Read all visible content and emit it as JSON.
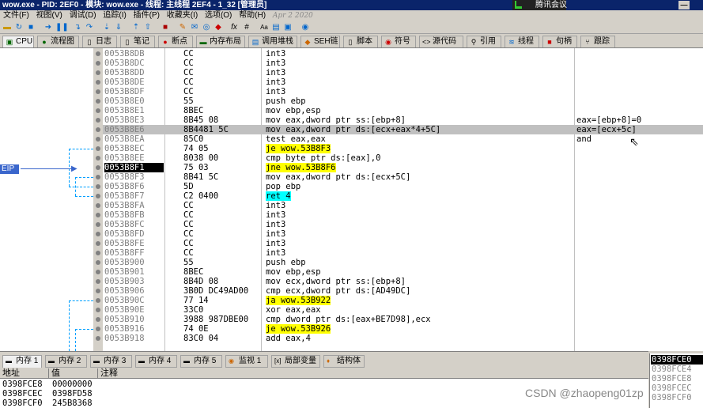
{
  "window": {
    "title": "wow.exe - PID: 2EF0 - 模块: wow.exe - 线程: 主线程 2EF4 - 1_32 [管理员]",
    "meeting": "腾讯会议",
    "minimize": "—"
  },
  "menu": [
    "文件(F)",
    "视图(V)",
    "调试(D)",
    "追踪(I)",
    "插件(P)",
    "收藏夹(I)",
    "选项(O)",
    "帮助(H)"
  ],
  "menu_date": "Apr 2 2020",
  "tabs": [
    {
      "label": "CPU",
      "icon": "cpu-icon"
    },
    {
      "label": "流程图",
      "icon": "graph-icon"
    },
    {
      "label": "日志",
      "icon": "log-icon"
    },
    {
      "label": "笔记",
      "icon": "notes-icon"
    },
    {
      "label": "断点",
      "icon": "breakpoint-icon"
    },
    {
      "label": "内存布局",
      "icon": "memory-map-icon"
    },
    {
      "label": "调用堆栈",
      "icon": "call-stack-icon"
    },
    {
      "label": "SEH链",
      "icon": "seh-icon"
    },
    {
      "label": "脚本",
      "icon": "script-icon"
    },
    {
      "label": "符号",
      "icon": "symbols-icon"
    },
    {
      "label": "源代码",
      "icon": "source-icon"
    },
    {
      "label": "引用",
      "icon": "references-icon"
    },
    {
      "label": "线程",
      "icon": "threads-icon"
    },
    {
      "label": "句柄",
      "icon": "handles-icon"
    },
    {
      "label": "跟踪",
      "icon": "trace-icon"
    }
  ],
  "eip_label": "EIP",
  "disasm": [
    {
      "addr": "0053B8DB",
      "bytes": "CC",
      "instr": "int3",
      "cmt": ""
    },
    {
      "addr": "0053B8DC",
      "bytes": "CC",
      "instr": "int3",
      "cmt": ""
    },
    {
      "addr": "0053B8DD",
      "bytes": "CC",
      "instr": "int3",
      "cmt": ""
    },
    {
      "addr": "0053B8DE",
      "bytes": "CC",
      "instr": "int3",
      "cmt": ""
    },
    {
      "addr": "0053B8DF",
      "bytes": "CC",
      "instr": "int3",
      "cmt": ""
    },
    {
      "addr": "0053B8E0",
      "bytes": "55",
      "instr": "push ebp",
      "cmt": ""
    },
    {
      "addr": "0053B8E1",
      "bytes": "8BEC",
      "instr": "mov ebp,esp",
      "cmt": ""
    },
    {
      "addr": "0053B8E3",
      "bytes": "8B45 08",
      "instr": "mov eax,dword ptr ss:[ebp+8]",
      "cmt": "eax=[ebp+8]=0"
    },
    {
      "addr": "0053B8E6",
      "bytes": "8B4481 5C",
      "instr": "mov eax,dword ptr ds:[ecx+eax*4+5C]",
      "cmt": "eax=[ecx+5c]"
    },
    {
      "addr": "0053B8EA",
      "bytes": "85C0",
      "instr": "test eax,eax",
      "cmt": "and"
    },
    {
      "addr": "0053B8EC",
      "bytes": "74 05",
      "instr": "je wow.53B8F3",
      "cmt": ""
    },
    {
      "addr": "0053B8EE",
      "bytes": "8038 00",
      "instr": "cmp byte ptr ds:[eax],0",
      "cmt": ""
    },
    {
      "addr": "0053B8F1",
      "bytes": "75 03",
      "instr": "jne wow.53B8F6",
      "cmt": ""
    },
    {
      "addr": "0053B8F3",
      "bytes": "8B41 5C",
      "instr": "mov eax,dword ptr ds:[ecx+5C]",
      "cmt": ""
    },
    {
      "addr": "0053B8F6",
      "bytes": "5D",
      "instr": "pop ebp",
      "cmt": ""
    },
    {
      "addr": "0053B8F7",
      "bytes": "C2 0400",
      "instr": "ret 4",
      "cmt": ""
    },
    {
      "addr": "0053B8FA",
      "bytes": "CC",
      "instr": "int3",
      "cmt": ""
    },
    {
      "addr": "0053B8FB",
      "bytes": "CC",
      "instr": "int3",
      "cmt": ""
    },
    {
      "addr": "0053B8FC",
      "bytes": "CC",
      "instr": "int3",
      "cmt": ""
    },
    {
      "addr": "0053B8FD",
      "bytes": "CC",
      "instr": "int3",
      "cmt": ""
    },
    {
      "addr": "0053B8FE",
      "bytes": "CC",
      "instr": "int3",
      "cmt": ""
    },
    {
      "addr": "0053B8FF",
      "bytes": "CC",
      "instr": "int3",
      "cmt": ""
    },
    {
      "addr": "0053B900",
      "bytes": "55",
      "instr": "push ebp",
      "cmt": ""
    },
    {
      "addr": "0053B901",
      "bytes": "8BEC",
      "instr": "mov ebp,esp",
      "cmt": ""
    },
    {
      "addr": "0053B903",
      "bytes": "8B4D 08",
      "instr": "mov ecx,dword ptr ss:[ebp+8]",
      "cmt": ""
    },
    {
      "addr": "0053B906",
      "bytes": "3B0D DC49AD00",
      "instr": "cmp ecx,dword ptr ds:[AD49DC]",
      "cmt": ""
    },
    {
      "addr": "0053B90C",
      "bytes": "77 14",
      "instr": "ja wow.53B922",
      "cmt": ""
    },
    {
      "addr": "0053B90E",
      "bytes": "33C0",
      "instr": "xor eax,eax",
      "cmt": ""
    },
    {
      "addr": "0053B910",
      "bytes": "3988 987DBE00",
      "instr": "cmp dword ptr ds:[eax+BE7D98],ecx",
      "cmt": ""
    },
    {
      "addr": "0053B916",
      "bytes": "74 0E",
      "instr": "je wow.53B926",
      "cmt": ""
    },
    {
      "addr": "0053B918",
      "bytes": "83C0 04",
      "instr": "add eax,4",
      "cmt": ""
    }
  ],
  "bottom_tabs": [
    {
      "label": "内存 1",
      "icon": "memory-icon"
    },
    {
      "label": "内存 2",
      "icon": "memory-icon"
    },
    {
      "label": "内存 3",
      "icon": "memory-icon"
    },
    {
      "label": "内存 4",
      "icon": "memory-icon"
    },
    {
      "label": "内存 5",
      "icon": "memory-icon"
    },
    {
      "label": "监视 1",
      "icon": "watch-icon"
    },
    {
      "label": "局部变量",
      "icon": "locals-icon"
    },
    {
      "label": "结构体",
      "icon": "struct-icon"
    }
  ],
  "dump": {
    "headers": [
      "地址",
      "值",
      "注释"
    ],
    "rows": [
      {
        "addr": "0398FCE8",
        "val": "00000000"
      },
      {
        "addr": "0398FCEC",
        "val": "0398FD58"
      },
      {
        "addr": "0398FCF0",
        "val": "245B8368"
      }
    ]
  },
  "stack": [
    "0398FCE0",
    "0398FCE4",
    "0398FCE8",
    "0398FCEC",
    "0398FCF0"
  ],
  "watermark": "CSDN @zhaopeng01zp",
  "colors": {
    "highlight_yellow": "#ffff00",
    "highlight_cyan": "#00ffff",
    "eip_blue": "#3a66cc",
    "title_blue": "#0a246a"
  }
}
